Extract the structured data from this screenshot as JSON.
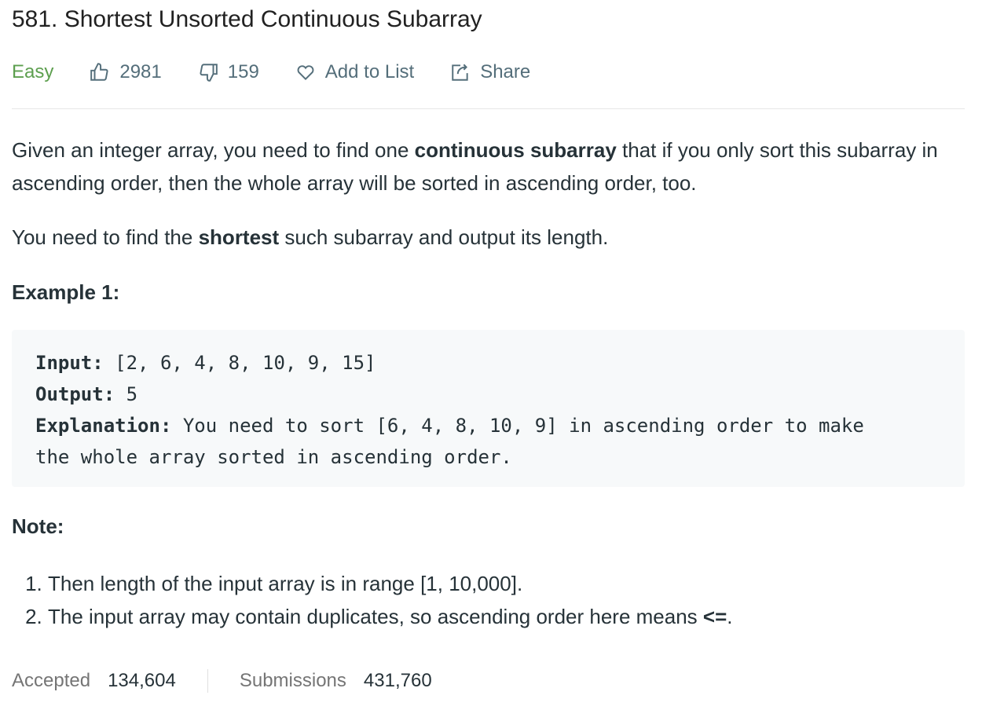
{
  "title": "581. Shortest Unsorted Continuous Subarray",
  "meta": {
    "difficulty": "Easy",
    "likes": "2981",
    "dislikes": "159",
    "add_to_list": "Add to List",
    "share": "Share",
    "colors": {
      "easy": "#5d9f4f"
    }
  },
  "description": {
    "p1": {
      "a": "Given an integer array, you need to find one ",
      "b": "continuous subarray",
      "c": " that if you only sort this subarray in ascending order, then the whole array will be sorted in ascending order, too."
    },
    "p2": {
      "a": "You need to find the ",
      "b": "shortest",
      "c": " such subarray and output its length."
    }
  },
  "example": {
    "heading": "Example 1:",
    "input_label": "Input:",
    "input": " [2, 6, 4, 8, 10, 9, 15]",
    "output_label": "Output:",
    "output": " 5",
    "explanation_label": "Explanation:",
    "explanation": " You need to sort [6, 4, 8, 10, 9] in ascending order to make\nthe whole array sorted in ascending order."
  },
  "note": {
    "heading": "Note:",
    "items": [
      "Then length of the input array is in range [1, 10,000].",
      "The input array may contain duplicates, so ascending order here means "
    ],
    "item2_bold": "<=",
    "item2_end": "."
  },
  "stats": {
    "accepted_label": "Accepted",
    "accepted": "134,604",
    "submissions_label": "Submissions",
    "submissions": "431,760"
  }
}
